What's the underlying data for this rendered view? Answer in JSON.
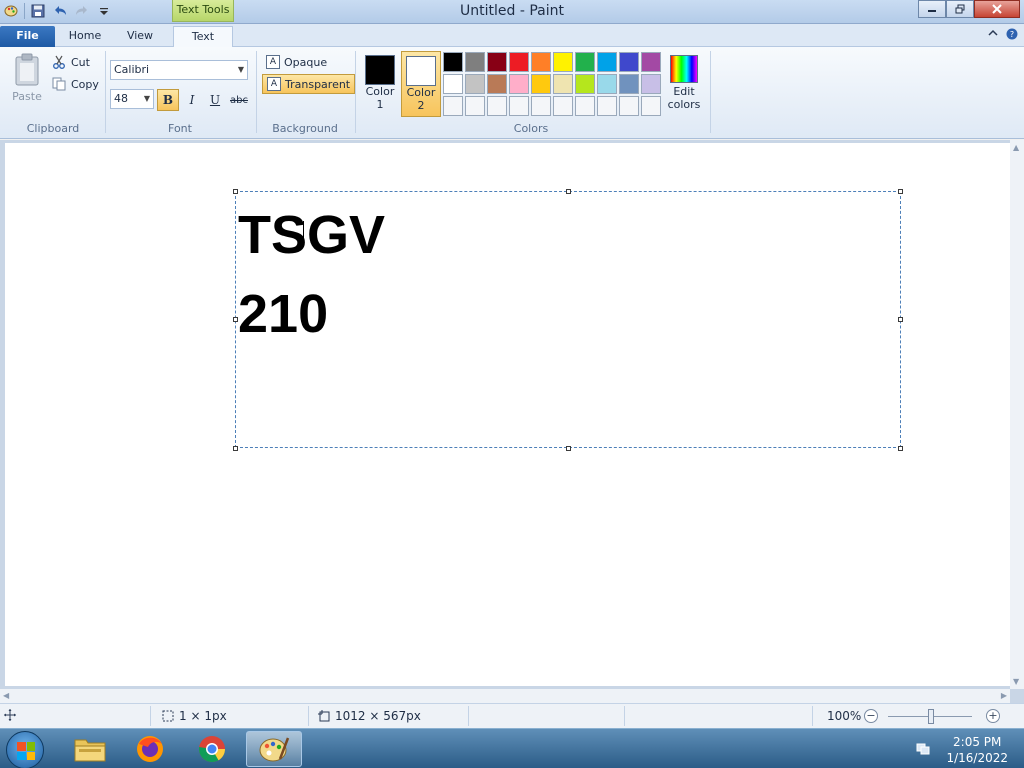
{
  "window": {
    "title": "Untitled - Paint",
    "context_tab": "Text Tools"
  },
  "tabs": {
    "file": "File",
    "home": "Home",
    "view": "View",
    "text": "Text"
  },
  "clipboard": {
    "paste": "Paste",
    "cut": "Cut",
    "copy": "Copy",
    "label": "Clipboard"
  },
  "font": {
    "family": "Calibri",
    "size": "48",
    "bold": "B",
    "italic": "I",
    "underline": "U",
    "strike": "abc",
    "label": "Font"
  },
  "background": {
    "opaque": "Opaque",
    "transparent": "Transparent",
    "label": "Background"
  },
  "colors": {
    "color1_label": "Color",
    "color1_num": "1",
    "color2_label": "Color",
    "color2_num": "2",
    "edit_label_1": "Edit",
    "edit_label_2": "colors",
    "label": "Colors",
    "color1": "#000000",
    "color2": "#ffffff",
    "palette": [
      "#000000",
      "#7f7f7f",
      "#880015",
      "#ed1c24",
      "#ff7f27",
      "#fff200",
      "#22b14c",
      "#00a2e8",
      "#3f48cc",
      "#a349a4",
      "#ffffff",
      "#c3c3c3",
      "#b97a57",
      "#ffaec9",
      "#ffc90e",
      "#efe4b0",
      "#b5e61d",
      "#99d9ea",
      "#7092be",
      "#c8bfe7",
      "#f4f6f9",
      "#f4f6f9",
      "#f4f6f9",
      "#f4f6f9",
      "#f4f6f9",
      "#f4f6f9",
      "#f4f6f9",
      "#f4f6f9",
      "#f4f6f9",
      "#f4f6f9"
    ]
  },
  "canvas": {
    "line1": "TSGV",
    "line2": "210"
  },
  "status": {
    "selection": "1 × 1px",
    "size": "1012 × 567px",
    "zoom": "100%",
    "zoom_level": 1.0
  },
  "taskbar": {
    "time": "2:05 PM",
    "date": "1/16/2022"
  }
}
